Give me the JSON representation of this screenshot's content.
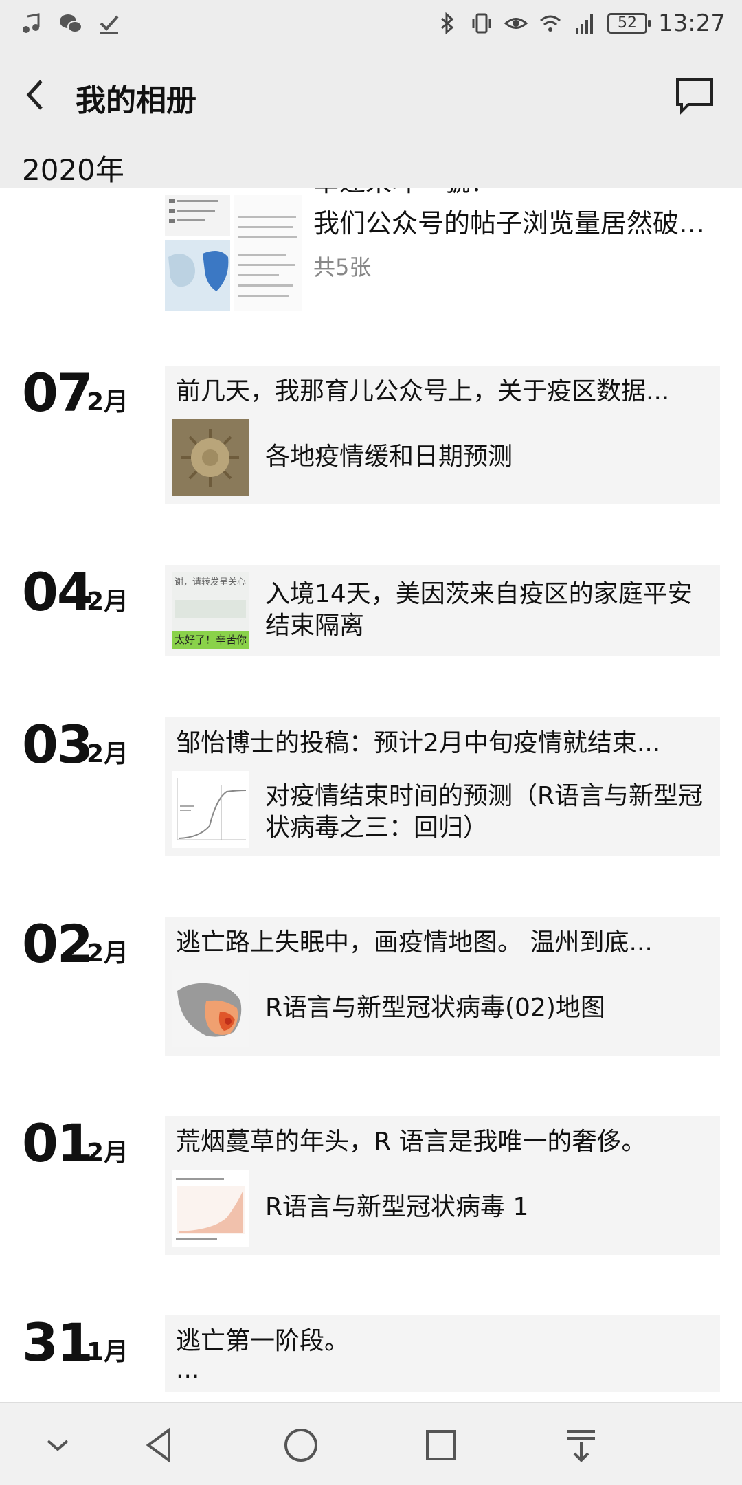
{
  "status_bar": {
    "time": "13:27",
    "battery": "52",
    "left_icons": [
      "music-note-icon",
      "wechat-icon",
      "check-download-icon"
    ],
    "right_icons": [
      "bluetooth-icon",
      "vibrate-icon",
      "eye-icon",
      "wifi-icon",
      "signal-icon"
    ]
  },
  "header": {
    "title": "我的相册"
  },
  "year_header": "2020年",
  "partial_top": {
    "cut_text": "幸運来叶一號！",
    "title": "我们公众号的帖子浏览量居然破2...",
    "count": "共5张"
  },
  "entries": [
    {
      "day": "07",
      "month": "2月",
      "caption": "前几天，我那育儿公众号上，关于疫区数据...",
      "link": "各地疫情缓和日期预测",
      "thumb": "virus"
    },
    {
      "day": "04",
      "month": "2月",
      "caption": "",
      "link": "入境14天，美因茨来自疫区的家庭平安结束隔离",
      "thumb": "chat",
      "thumb_text_top": "谢，请转发呈关心",
      "thumb_text_bottom": "太好了！辛苦你"
    },
    {
      "day": "03",
      "month": "2月",
      "caption": "邹怡博士的投稿：预计2月中旬疫情就结束...",
      "link": "对疫情结束时间的预测（R语言与新型冠状病毒之三：回归）",
      "thumb": "curve"
    },
    {
      "day": "02",
      "month": "2月",
      "caption": "逃亡路上失眠中，画疫情地图。 温州到底...",
      "link": "R语言与新型冠状病毒(02)地图",
      "thumb": "map"
    },
    {
      "day": "01",
      "month": "2月",
      "caption": "荒烟蔓草的年头，R 语言是我唯一的奢侈。",
      "link": "R语言与新型冠状病毒 1",
      "thumb": "chart"
    },
    {
      "day": "31",
      "month": "1月",
      "caption": "逃亡第一阶段。",
      "caption2": "...",
      "link": "",
      "thumb": ""
    }
  ],
  "navbar": [
    "collapse-icon",
    "back-triangle-icon",
    "home-circle-icon",
    "recents-square-icon",
    "notification-pull-icon"
  ]
}
